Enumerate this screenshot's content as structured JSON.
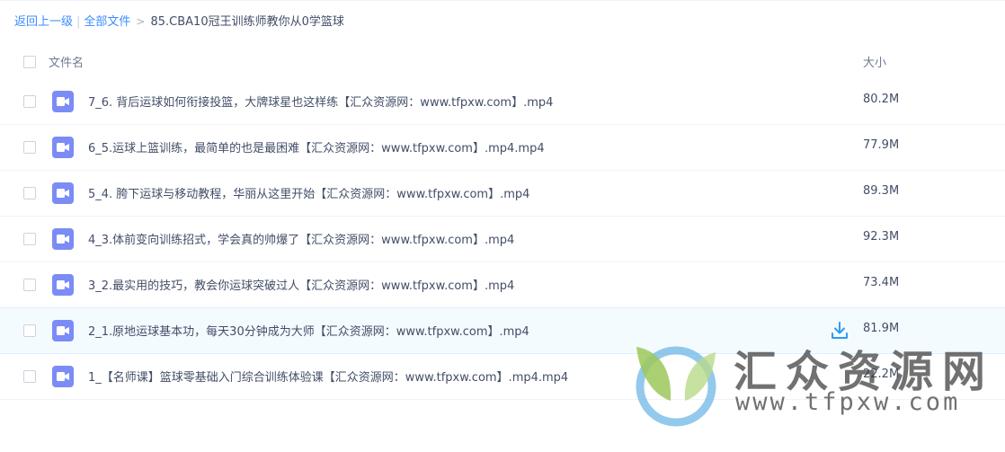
{
  "breadcrumb": {
    "back": "返回上一级",
    "separator": "|",
    "all_files": "全部文件",
    "arrow": ">",
    "current": "85.CBA10冠王训练师教你从0学篮球"
  },
  "table": {
    "col_name": "文件名",
    "col_size": "大小",
    "rows": [
      {
        "name": "7_6. 背后运球如何衔接投篮，大牌球星也这样练【汇众资源网：www.tfpxw.com】.mp4",
        "size": "80.2M"
      },
      {
        "name": "6_5.运球上篮训练，最简单的也是最困难【汇众资源网：www.tfpxw.com】.mp4.mp4",
        "size": "77.9M"
      },
      {
        "name": "5_4. 胯下运球与移动教程，华丽从这里开始【汇众资源网：www.tfpxw.com】.mp4",
        "size": "89.3M"
      },
      {
        "name": "4_3.体前变向训练招式，学会真的帅爆了【汇众资源网：www.tfpxw.com】.mp4",
        "size": "92.3M"
      },
      {
        "name": "3_2.最实用的技巧，教会你运球突破过人【汇众资源网：www.tfpxw.com】.mp4",
        "size": "73.4M"
      },
      {
        "name": "2_1.原地运球基本功，每天30分钟成为大师【汇众资源网：www.tfpxw.com】.mp4",
        "size": "81.9M"
      },
      {
        "name": "1_【名师课】篮球零基础入门综合训练体验课【汇众资源网：www.tfpxw.com】.mp4.mp4",
        "size": "22.2M"
      }
    ]
  },
  "watermark": {
    "cn": "汇众资源网",
    "en": "www.tfpxw.com"
  },
  "colors": {
    "link": "#3b8cff",
    "video_icon": "#7b8cf6",
    "hover_row": "#f4fbff",
    "download": "#2f9bf0"
  },
  "icons": {
    "file": "video-file-icon",
    "download": "download-icon"
  }
}
